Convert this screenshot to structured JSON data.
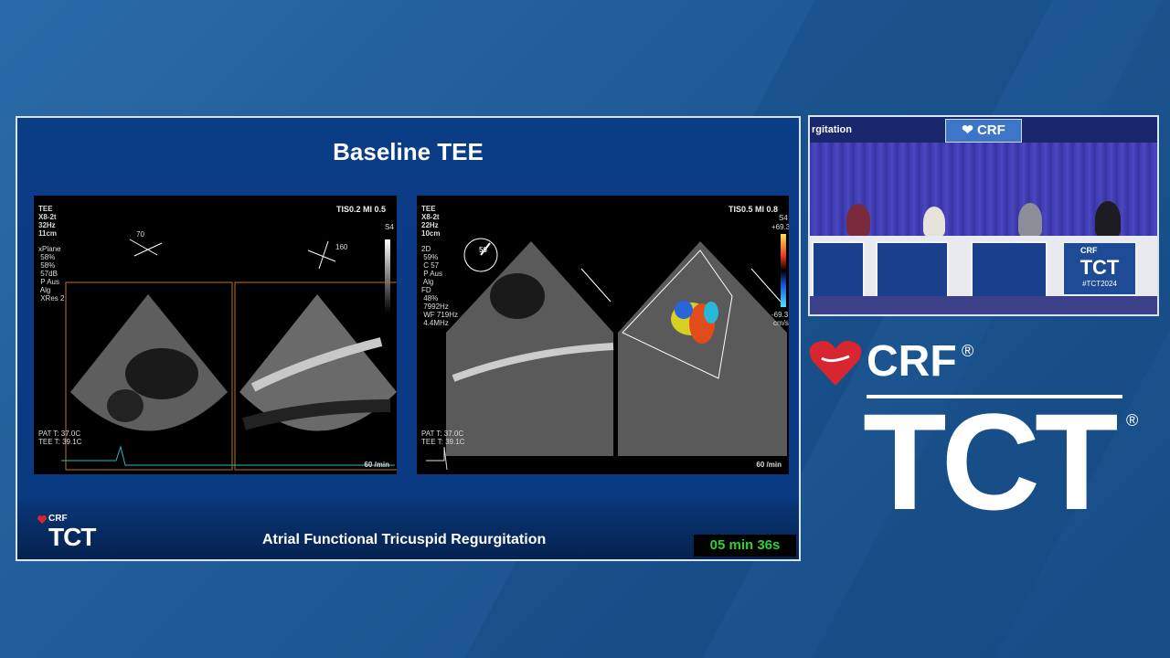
{
  "slide": {
    "title": "Baseline TEE",
    "footer": "Atrial Functional Tricuspid Regurgitation",
    "timer": "05 min 36s",
    "logo_crf": "CRF",
    "logo_tct": "TCT"
  },
  "echo_left": {
    "header_left": "TEE\nX8-2t\n32Hz\n11cm",
    "header_right": "TIS0.2  MI 0.5",
    "params": "xPlane\n 58%\n 58%\n 57dB\n P Aus\n Alg\n XRes 2",
    "angle1": "70",
    "angle2": "160",
    "temp": "PAT T: 37.0C\nTEE T: 39.1C",
    "rate": "60 /min",
    "scale": "S4"
  },
  "echo_right": {
    "header_left": "TEE\nX8-2t\n22Hz\n10cm",
    "header_right": "TIS0.5  MI 0.8",
    "params": "2D\n 59%\n C 57\n P Aus\n Alg\nFD\n 48%\n 7992Hz\n WF 719Hz\n 4.4MHz",
    "angle": "50",
    "temp": "PAT T: 37.0C\nTEE T: 39.1C",
    "rate": "60 /min",
    "scale_top": "+69.3",
    "scale_bottom": "-69.3",
    "scale_unit": "cm/s",
    "scale_label": "S4"
  },
  "camera": {
    "label": "rgitation",
    "crf": "CRF",
    "tct": "TCT",
    "hashtag": "#TCT2024"
  },
  "brand": {
    "crf": "CRF",
    "tct": "TCT",
    "reg": "®"
  },
  "colors": {
    "background": "#1f5a96",
    "slide": "#0a3a82",
    "timer_text": "#2fd12f",
    "heart": "#d7262f"
  }
}
